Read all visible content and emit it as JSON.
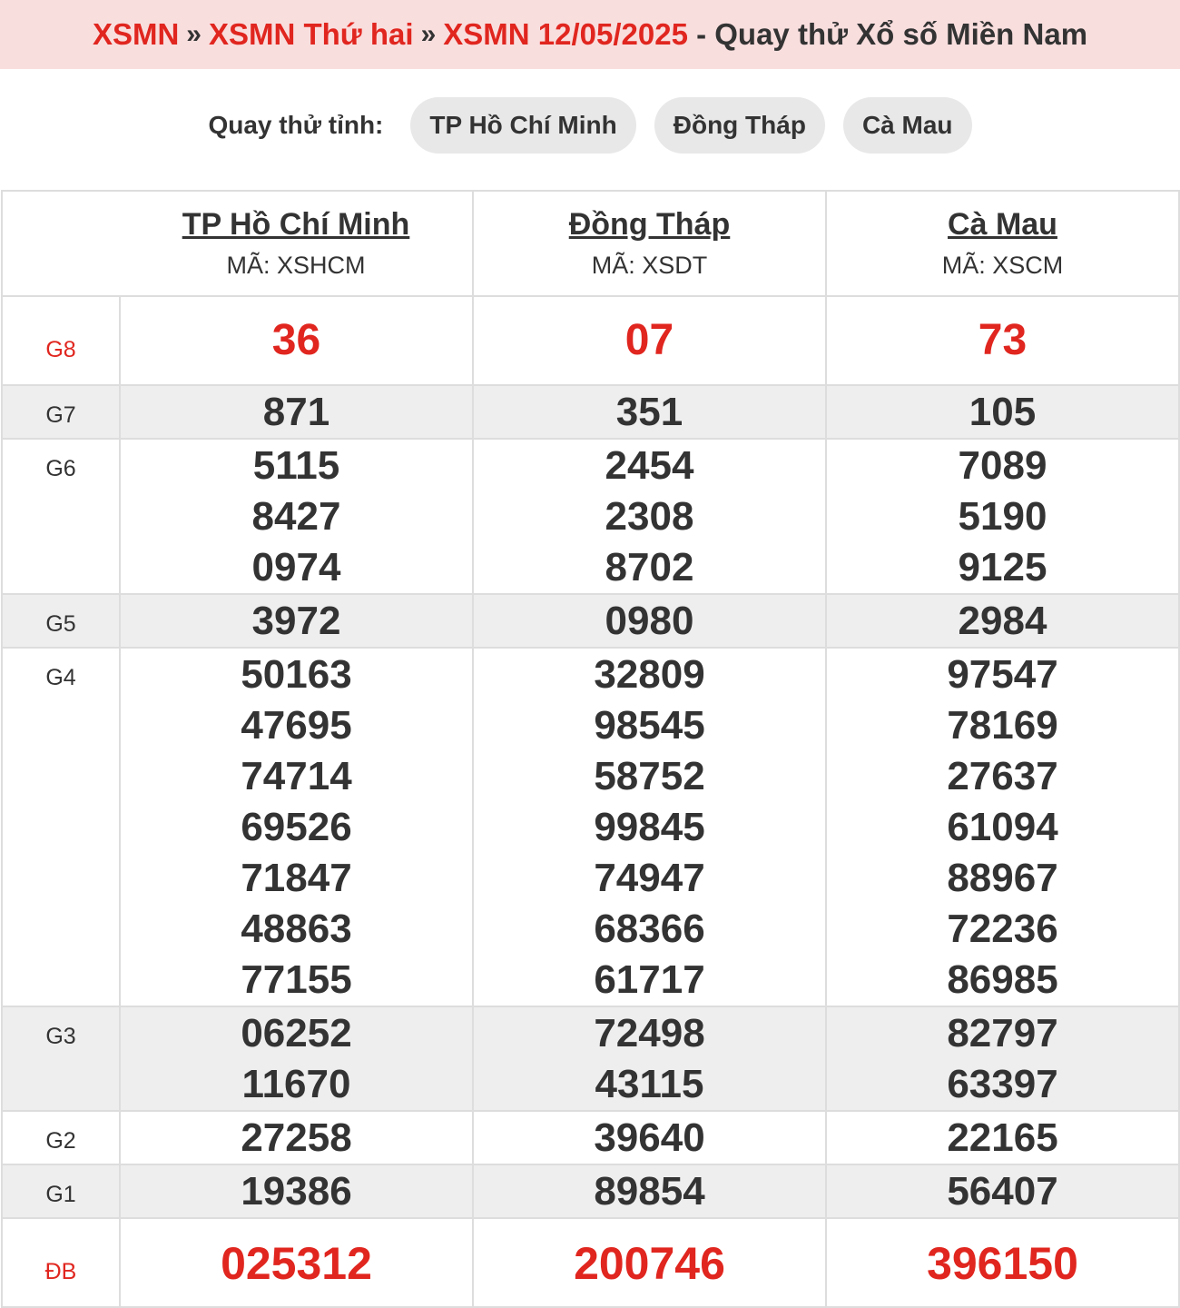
{
  "breadcrumb": {
    "home": "XSMN",
    "separator": "»",
    "day": "XSMN Thứ hai",
    "date": "XSMN 12/05/2025",
    "suffix": " - Quay thử Xổ số Miền Nam"
  },
  "picker": {
    "label": "Quay thử tỉnh:",
    "options": [
      "TP Hồ Chí Minh",
      "Đồng Tháp",
      "Cà Mau"
    ]
  },
  "table": {
    "provinces": [
      {
        "name": "TP Hồ Chí Minh",
        "code": "MÃ: XSHCM"
      },
      {
        "name": "Đồng Tháp",
        "code": "MÃ: XSDT"
      },
      {
        "name": "Cà Mau",
        "code": "MÃ: XSCM"
      }
    ],
    "prizes": {
      "g8": {
        "label": "G8",
        "values": [
          [
            "36"
          ],
          [
            "07"
          ],
          [
            "73"
          ]
        ]
      },
      "g7": {
        "label": "G7",
        "values": [
          [
            "871"
          ],
          [
            "351"
          ],
          [
            "105"
          ]
        ]
      },
      "g6": {
        "label": "G6",
        "values": [
          [
            "5115",
            "8427",
            "0974"
          ],
          [
            "2454",
            "2308",
            "8702"
          ],
          [
            "7089",
            "5190",
            "9125"
          ]
        ]
      },
      "g5": {
        "label": "G5",
        "values": [
          [
            "3972"
          ],
          [
            "0980"
          ],
          [
            "2984"
          ]
        ]
      },
      "g4": {
        "label": "G4",
        "values": [
          [
            "50163",
            "47695",
            "74714",
            "69526",
            "71847",
            "48863",
            "77155"
          ],
          [
            "32809",
            "98545",
            "58752",
            "99845",
            "74947",
            "68366",
            "61717"
          ],
          [
            "97547",
            "78169",
            "27637",
            "61094",
            "88967",
            "72236",
            "86985"
          ]
        ]
      },
      "g3": {
        "label": "G3",
        "values": [
          [
            "06252",
            "11670"
          ],
          [
            "72498",
            "43115"
          ],
          [
            "82797",
            "63397"
          ]
        ]
      },
      "g2": {
        "label": "G2",
        "values": [
          [
            "27258"
          ],
          [
            "39640"
          ],
          [
            "22165"
          ]
        ]
      },
      "g1": {
        "label": "G1",
        "values": [
          [
            "19386"
          ],
          [
            "89854"
          ],
          [
            "56407"
          ]
        ]
      },
      "db": {
        "label": "ĐB",
        "values": [
          [
            "025312"
          ],
          [
            "200746"
          ],
          [
            "396150"
          ]
        ]
      }
    }
  },
  "colors": {
    "accent_red": "#e0261f",
    "title_bg": "#f9dede",
    "row_shade": "#eeeeee",
    "pill_bg": "#e8e8e8"
  }
}
